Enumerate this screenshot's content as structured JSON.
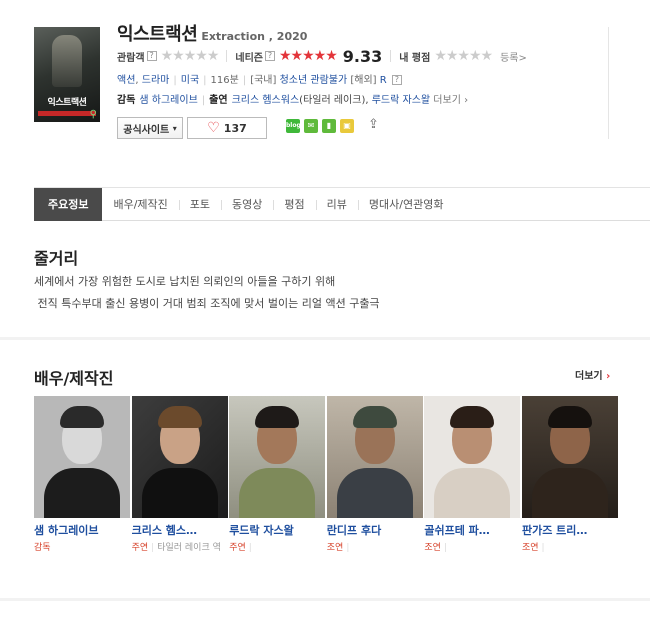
{
  "movie": {
    "title_kr": "익스트랙션",
    "title_en": "Extraction , 2020",
    "poster_title": "익스트랙션"
  },
  "ratings": {
    "audience_label": "관람객",
    "netizen_label": "네티즌",
    "netizen_score": "9.33",
    "my_label": "내 평점",
    "register_label": "등록",
    "help_mark": "?"
  },
  "info": {
    "genres": [
      "액션",
      "드라마"
    ],
    "country": "미국",
    "runtime": "116분",
    "grade_kr_prefix": "[국내]",
    "grade_kr": "청소년 관람불가",
    "grade_intl_prefix": "[해외]",
    "grade_intl": "R"
  },
  "staff": {
    "director_label": "감독",
    "director": "샘 하그레이브",
    "cast_label": "출연",
    "cast_1": "크리스 헴스워스",
    "cast_1_role": "(타일러 레이크)",
    "cast_2": "루드락 자스왈",
    "more": "더보기"
  },
  "actions": {
    "official_site": "공식사이트",
    "like_count": "137"
  },
  "tabs": [
    "주요정보",
    "배우/제작진",
    "포토",
    "동영상",
    "평점",
    "리뷰",
    "명대사/연관영화"
  ],
  "synopsis": {
    "heading": "줄거리",
    "line1": "세계에서 가장 위험한 도시로 납치된 의뢰인의 아들을 구하기 위해",
    "line2": " 전직 특수부대 출신 용병이 거대 범죄 조직에 맞서 벌이는 리얼 액션 구출극"
  },
  "cast_section": {
    "heading": "배우/제작진",
    "more": "더보기",
    "people": [
      {
        "name": "샘 하그레이브",
        "position": "감독",
        "role": ""
      },
      {
        "name": "크리스 헴스…",
        "position": "주연",
        "role": "타일러 레이크 역"
      },
      {
        "name": "루드락 자스왈",
        "position": "주연",
        "role": ""
      },
      {
        "name": "란디프 후다",
        "position": "조연",
        "role": ""
      },
      {
        "name": "골쉬프테 파…",
        "position": "조연",
        "role": ""
      },
      {
        "name": "판가즈 트리…",
        "position": "조연",
        "role": ""
      }
    ]
  },
  "colors": {
    "link": "#1f4f9f",
    "accent_red": "#e3343a",
    "tab_active_bg": "#4a4a4a"
  }
}
